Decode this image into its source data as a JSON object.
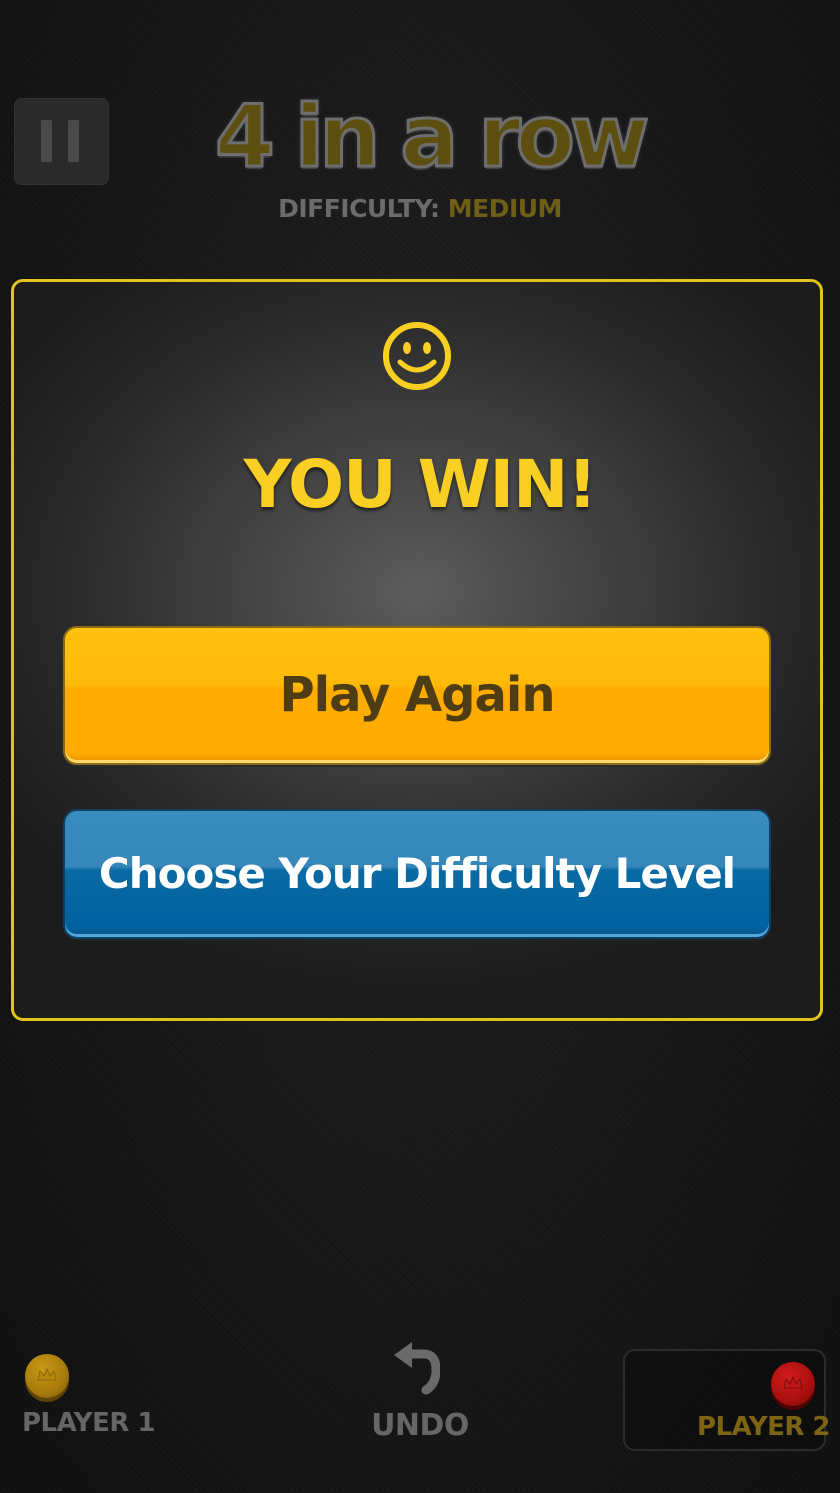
{
  "header": {
    "logo_text": "4 in a row",
    "difficulty_label": "DIFFICULTY:",
    "difficulty_value": "MEDIUM",
    "pause_icon": "pause-icon"
  },
  "dialog": {
    "icon": "smiley-icon",
    "title": "YOU WIN!",
    "play_again_label": "Play Again",
    "choose_difficulty_label": "Choose Your Difficulty Level"
  },
  "bottom_bar": {
    "player1_label": "PLAYER 1",
    "undo_label": "UNDO",
    "undo_icon": "undo-icon",
    "player2_label": "PLAYER 2",
    "active_player": "PLAYER 2"
  },
  "colors": {
    "accent_yellow": "#f8cf22",
    "dialog_border": "#e2c21c",
    "play_again_button": "#ffb400",
    "difficulty_button": "#0a6aa3",
    "player1_chip": "#a67a0a",
    "player2_chip": "#a80f0f"
  }
}
